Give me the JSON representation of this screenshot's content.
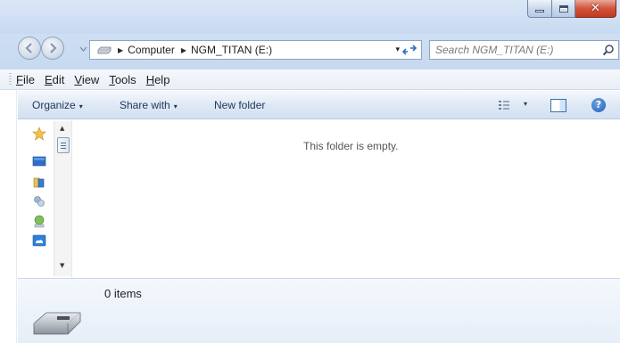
{
  "window": {
    "controls": {
      "minimize_icon": "minimize-icon",
      "maximize_icon": "maximize-icon",
      "close_icon": "close-icon",
      "close_glyph": "✕"
    }
  },
  "address": {
    "breadcrumbs": [
      "Computer",
      "NGM_TITAN (E:)"
    ],
    "separator_glyph": "▶",
    "dropdown_glyph": "▾"
  },
  "search": {
    "placeholder": "Search NGM_TITAN (E:)"
  },
  "menu": {
    "items": [
      {
        "key": "F",
        "rest": "ile"
      },
      {
        "key": "E",
        "rest": "dit"
      },
      {
        "key": "V",
        "rest": "iew"
      },
      {
        "key": "T",
        "rest": "ools"
      },
      {
        "key": "H",
        "rest": "elp"
      }
    ]
  },
  "commandbar": {
    "organize": "Organize",
    "share_with": "Share with",
    "new_folder": "New folder",
    "caret": "▾",
    "help_glyph": "?"
  },
  "navpane": {
    "icons": [
      "favorites-star-icon",
      "desktop-icon",
      "libraries-icon",
      "homegroup-icon",
      "network-icon",
      "onedrive-icon"
    ],
    "scroll_up": "▲",
    "scroll_down": "▼"
  },
  "content": {
    "empty_message": "This folder is empty."
  },
  "details": {
    "item_count": "0 items"
  },
  "colors": {
    "accent": "#1e3658",
    "close_red": "#c23a22",
    "frame": "#cfdff3"
  }
}
